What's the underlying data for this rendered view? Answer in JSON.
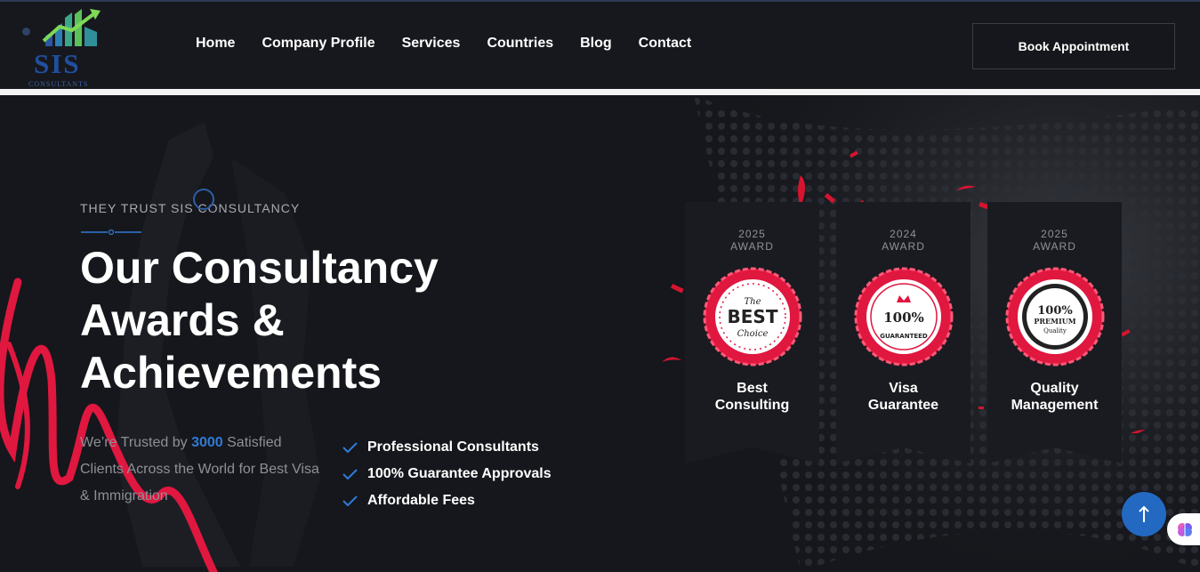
{
  "brand": {
    "logo_text": "SIS",
    "logo_sub": "CONSULTANTS"
  },
  "nav": {
    "items": [
      {
        "label": "Home"
      },
      {
        "label": "Company Profile"
      },
      {
        "label": "Services"
      },
      {
        "label": "Countries"
      },
      {
        "label": "Blog"
      },
      {
        "label": "Contact"
      }
    ],
    "cta": "Book Appointment"
  },
  "hero": {
    "eyebrow": "THEY TRUST SIS CONSULTANCY",
    "heading_lines": [
      "Our Consultancy",
      "Awards &",
      "Achievements"
    ],
    "desc_before": "We’re Trusted by ",
    "desc_highlight": "3000",
    "desc_after": " Satisfied Clients Across the World for Best Visa & Immigration",
    "features": [
      "Professional Consultants",
      "100% Guarantee Approvals",
      "Affordable Fees"
    ]
  },
  "awards": [
    {
      "year": "2025",
      "label": "AWARD",
      "title_1": "Best",
      "title_2": "Consulting",
      "seal": "best-choice"
    },
    {
      "year": "2024",
      "label": "AWARD",
      "title_1": "Visa",
      "title_2": "Guarantee",
      "seal": "100-guaranteed"
    },
    {
      "year": "2025",
      "label": "AWARD",
      "title_1": "Quality",
      "title_2": "Management",
      "seal": "100-premium-quality"
    }
  ],
  "seal_text": {
    "best_1": "The",
    "best_2": "BEST",
    "best_3": "Choice",
    "guar_1": "100%",
    "guar_2": "GUARANTEED",
    "prem_1": "100%",
    "prem_2": "PREMIUM",
    "prem_3": "Quality"
  },
  "colors": {
    "accent_blue": "#2f7bd9",
    "accent_red": "#e0173f",
    "background": "#15171c",
    "header": "#17181d"
  },
  "icons": {
    "scroll_top": "arrow-up-icon",
    "floating": "brain-icon",
    "feature": "check-icon"
  }
}
